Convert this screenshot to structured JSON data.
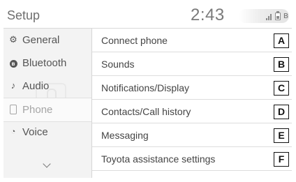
{
  "header": {
    "title": "Setup",
    "clock": "2:43",
    "status_icons": [
      "signal-icon",
      "battery-icon",
      "bluetooth-icon"
    ]
  },
  "sidebar": {
    "items": [
      {
        "label": "General",
        "icon": "gear-icon"
      },
      {
        "label": "Bluetooth",
        "icon": "bluetooth-icon"
      },
      {
        "label": "Audio",
        "icon": "music-note-icon"
      },
      {
        "label": "Phone",
        "icon": "phone-icon",
        "selected": true
      },
      {
        "label": "Voice",
        "icon": "voice-icon"
      }
    ],
    "more_icon": "chevron-down-icon"
  },
  "menu": {
    "items": [
      {
        "label": "Connect phone",
        "callout": "A"
      },
      {
        "label": "Sounds",
        "callout": "B"
      },
      {
        "label": "Notifications/Display",
        "callout": "C"
      },
      {
        "label": "Contacts/Call history",
        "callout": "D"
      },
      {
        "label": "Messaging",
        "callout": "E"
      },
      {
        "label": "Toyota assistance settings",
        "callout": "F"
      }
    ]
  },
  "colors": {
    "sidebar_bg": "#f3f3f3",
    "text": "#444444",
    "selected_text": "#a5a5a5",
    "divider": "#dddddd",
    "callout_border": "#111111"
  }
}
